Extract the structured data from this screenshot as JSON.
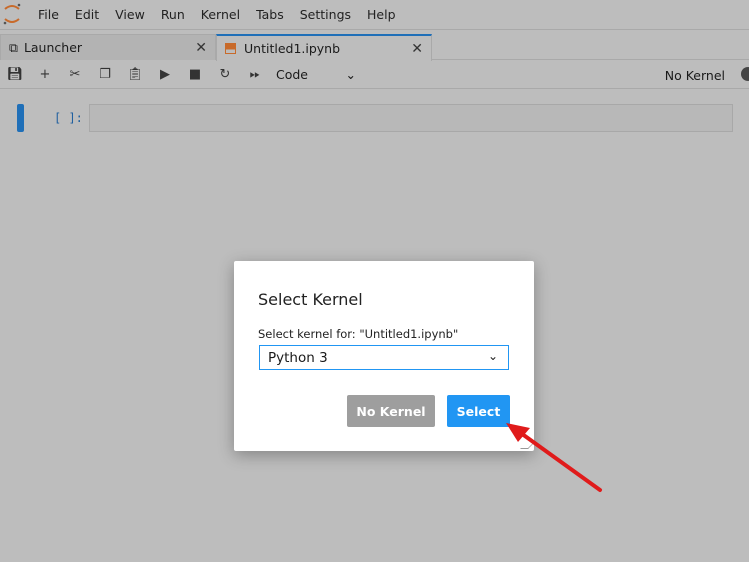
{
  "menubar": {
    "items": [
      "File",
      "Edit",
      "View",
      "Run",
      "Kernel",
      "Tabs",
      "Settings",
      "Help"
    ]
  },
  "tabs": [
    {
      "label": "Launcher",
      "icon": "launcher-icon"
    },
    {
      "label": "Untitled1.ipynb",
      "icon": "notebook-icon",
      "active": true
    }
  ],
  "toolbar": {
    "icons": [
      "save-icon",
      "plus-icon",
      "cut-icon",
      "copy-icon",
      "paste-icon",
      "run-icon",
      "stop-icon",
      "restart-icon",
      "fast-forward-icon"
    ],
    "cell_type": "Code",
    "kernel_status": "No Kernel"
  },
  "cell": {
    "prompt": "[ ]:"
  },
  "dialog": {
    "title": "Select Kernel",
    "label": "Select kernel for: \"Untitled1.ipynb\"",
    "selected": "Python 3",
    "no_kernel": "No Kernel",
    "select": "Select"
  },
  "colors": {
    "accent": "#2196f3",
    "arrow": "#e01b1b",
    "logo": "#f37726"
  }
}
